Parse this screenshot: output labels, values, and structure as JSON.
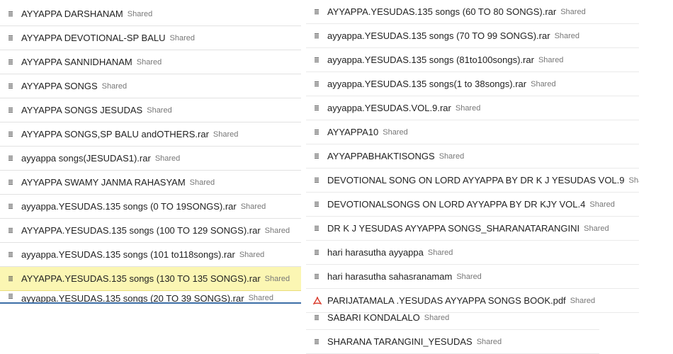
{
  "shared_label": "Shared",
  "left_files": [
    {
      "name": "AYYAPPA DARSHANAM",
      "shared": "Shared"
    },
    {
      "name": "AYYAPPA DEVOTIONAL-SP BALU",
      "shared": "Shared"
    },
    {
      "name": "AYYAPPA SANNIDHANAM",
      "shared": "Shared"
    },
    {
      "name": "AYYAPPA SONGS",
      "shared": "Shared"
    },
    {
      "name": "AYYAPPA SONGS JESUDAS",
      "shared": "Shared"
    },
    {
      "name": "AYYAPPA SONGS,SP BALU andOTHERS.rar",
      "shared": "Shared"
    },
    {
      "name": "ayyappa songs(JESUDAS1).rar",
      "shared": "Shared"
    },
    {
      "name": "AYYAPPA SWAMY JANMA RAHASYAM",
      "shared": "Shared"
    },
    {
      "name": "ayyappa.YESUDAS.135 songs (0 TO 19SONGS).rar",
      "shared": "Shared"
    },
    {
      "name": "AYYAPPA.YESUDAS.135 songs (100 TO 129 SONGS).rar",
      "shared": "Shared"
    },
    {
      "name": "ayyappa.YESUDAS.135 songs (101 to118songs).rar",
      "shared": "Shared"
    },
    {
      "name": "AYYAPPA.YESUDAS.135 songs (130 TO 135 SONGS).rar",
      "shared": "Shared"
    },
    {
      "name": "ayyappa.YESUDAS.135 songs (20 TO 39 SONGS).rar",
      "shared": "Shared"
    }
  ],
  "right_files": [
    {
      "name": "AYYAPPA.YESUDAS.135 songs (60 TO 80 SONGS).rar",
      "shared": "Shared"
    },
    {
      "name": "ayyappa.YESUDAS.135 songs (70 TO 99 SONGS).rar",
      "shared": "Shared"
    },
    {
      "name": "ayyappa.YESUDAS.135 songs (81to100songs).rar",
      "shared": "Shared"
    },
    {
      "name": "ayyappa.YESUDAS.135 songs(1 to 38songs).rar",
      "shared": "Shared"
    },
    {
      "name": "ayyappa.YESUDAS.VOL.9.rar",
      "shared": "Shared"
    },
    {
      "name": "AYYAPPA10",
      "shared": "Shared"
    },
    {
      "name": "AYYAPPABHAKTISONGS",
      "shared": "Shared"
    },
    {
      "name": "DEVOTIONAL SONG ON LORD AYYAPPA BY DR K J YESUDAS VOL.9",
      "shared": "Shared"
    },
    {
      "name": "DEVOTIONALSONGS ON LORD AYYAPPA BY DR KJY VOL.4",
      "shared": "Shared"
    },
    {
      "name": "DR K J YESUDAS AYYAPPA SONGS_SHARANATARANGINI",
      "shared": "Shared"
    },
    {
      "name": "hari harasutha ayyappa",
      "shared": "Shared"
    },
    {
      "name": "hari harasutha sahasranamam",
      "shared": "Shared"
    },
    {
      "name": "PARIJATAMALA .YESUDAS AYYAPPA SONGS BOOK.pdf",
      "shared": "Shared",
      "icon": "pdf-icon"
    }
  ],
  "right_files_bottom": [
    {
      "name": "SABARI KONDALALO",
      "shared": "Shared"
    },
    {
      "name": "SHARANA TARANGINI_YESUDAS",
      "shared": "Shared"
    }
  ],
  "highlight_color": "#fbf6b3",
  "pdf_icon_color": "#d93a2b"
}
